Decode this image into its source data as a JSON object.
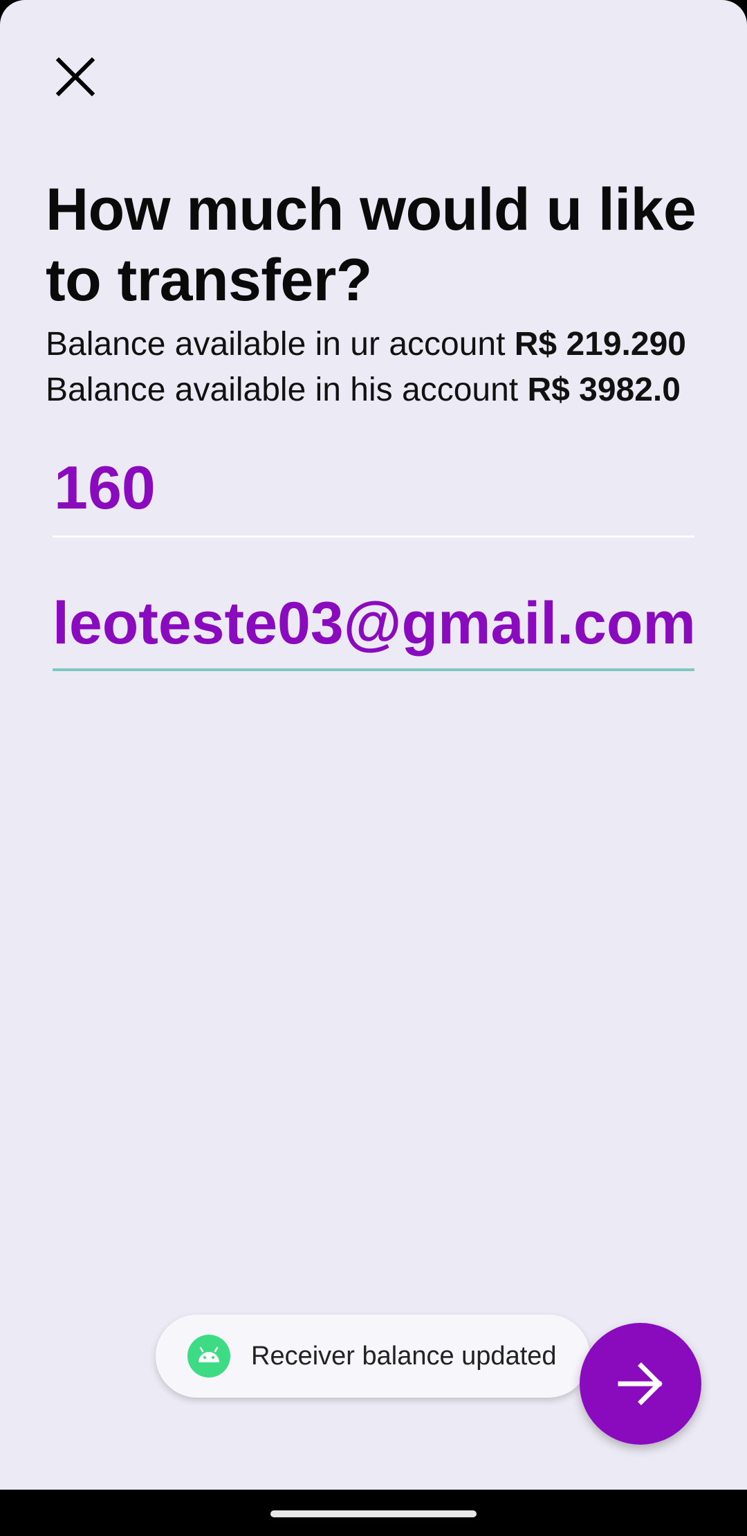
{
  "header": {
    "close_icon": "close-icon",
    "title": "How much would u like to transfer?"
  },
  "balances": {
    "own_label": "Balance available in ur account ",
    "own_amount": "R$ 219.290",
    "other_label": "Balance available in his account ",
    "other_amount": "R$ 3982.0"
  },
  "form": {
    "amount_value": "160",
    "email_value": "leoteste03@gmail.com",
    "accent_color": "#8a0bbd",
    "focus_underline_color": "#7ec8c1"
  },
  "toast": {
    "icon": "android-icon",
    "message": "Receiver balance updated"
  },
  "fab": {
    "icon": "arrow-right-icon",
    "color": "#8a0bbd"
  },
  "colors": {
    "background": "#ecebf5"
  }
}
